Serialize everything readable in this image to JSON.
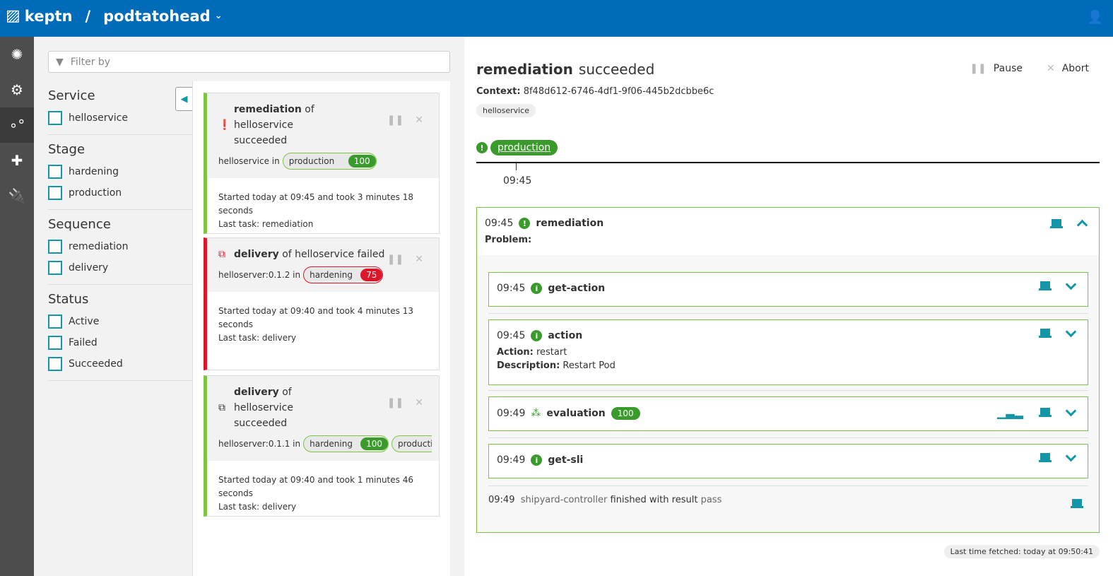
{
  "header": {
    "brand": "keptn",
    "separator": "/",
    "project": "podtatohead"
  },
  "nav": [
    {
      "icon": "environment-icon"
    },
    {
      "icon": "settings-icon"
    },
    {
      "icon": "sequences-icon",
      "active": true
    },
    {
      "icon": "services-icon"
    },
    {
      "icon": "integrations-icon"
    }
  ],
  "filter": {
    "placeholder": "Filter by"
  },
  "facets": [
    {
      "title": "Service",
      "items": [
        "helloservice"
      ]
    },
    {
      "title": "Stage",
      "items": [
        "hardening",
        "production"
      ]
    },
    {
      "title": "Sequence",
      "items": [
        "remediation",
        "delivery"
      ]
    },
    {
      "title": "Status",
      "items": [
        "Active",
        "Failed",
        "Succeeded"
      ]
    }
  ],
  "sequences": [
    {
      "name": "remediation",
      "of": "of",
      "service": "helloservice",
      "status": "succeeded",
      "artifact": "helloservice in",
      "stages": [
        {
          "name": "production",
          "score": "100",
          "color": "green"
        }
      ],
      "started": "Started today at 09:45 and took 3 minutes 18 seconds",
      "last_task": "Last task: remediation",
      "icon": "problem-icon"
    },
    {
      "name": "delivery",
      "of": "of",
      "service": "helloservice",
      "status": "failed",
      "artifact": "helloserver:0.1.2 in",
      "stages": [
        {
          "name": "hardening",
          "score": "75",
          "color": "red"
        }
      ],
      "started": "Started today at 09:40 and took 4 minutes 13 seconds",
      "last_task": "Last task: delivery",
      "icon": "deploy-icon"
    },
    {
      "name": "delivery",
      "of": "of",
      "service": "helloservice",
      "status": "succeeded",
      "artifact": "helloserver:0.1.1 in",
      "stages": [
        {
          "name": "hardening",
          "score": "100",
          "color": "green"
        },
        {
          "name": "production",
          "score": "",
          "color": "green"
        }
      ],
      "started": "Started today at 09:40 and took 1 minutes 46 seconds",
      "last_task": "Last task: delivery",
      "icon": "deploy-icon"
    }
  ],
  "detail": {
    "name": "remediation",
    "status": "succeeded",
    "pause": "Pause",
    "abort": "Abort",
    "context_label": "Context:",
    "context": "8f48d612-6746-4df1-9f06-445b2dcbbe6c",
    "service": "helloservice",
    "stage": "production",
    "tick": "09:45",
    "head": {
      "time": "09:45",
      "name": "remediation",
      "problem_label": "Problem:"
    },
    "tasks": [
      {
        "time": "09:45",
        "name": "get-action"
      },
      {
        "time": "09:45",
        "name": "action",
        "action_label": "Action:",
        "action": "restart",
        "desc_label": "Description:",
        "desc": "Restart Pod"
      },
      {
        "time": "09:49",
        "name": "evaluation",
        "score": "100"
      },
      {
        "time": "09:49",
        "name": "get-sli"
      }
    ],
    "final": {
      "time": "09:49",
      "source": "shipyard-controller",
      "text": "finished with result",
      "result": "pass"
    },
    "fetched": "Last time fetched: today at 09:50:41"
  },
  "colors": {
    "header": "#006bb8",
    "success": "#3a9b2c",
    "failed": "#dc172a",
    "accent": "#1496a8"
  }
}
